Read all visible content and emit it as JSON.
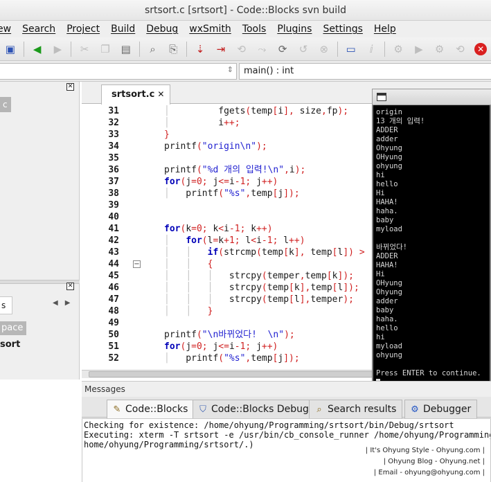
{
  "window": {
    "title": "srtsort.c [srtsort] - Code::Blocks svn build"
  },
  "menu": [
    "ew",
    "Search",
    "Project",
    "Build",
    "Debug",
    "wxSmith",
    "Tools",
    "Plugins",
    "Settings",
    "Help"
  ],
  "context": {
    "scope": "",
    "function": "main() : int"
  },
  "left_panel": {
    "button_fragment": "c",
    "tab_fragment": "s",
    "highlight_fragment": "pace",
    "bold_fragment": "sort"
  },
  "editor": {
    "tab_label": "srtsort.c",
    "tab_close": "✕",
    "lines": [
      {
        "n": "31",
        "html": "<span class=\"gl\">│</span>         fgets<span class=\"op\">(</span>temp<span class=\"op\">[</span>i<span class=\"op\">],</span> size<span class=\"op\">,</span>fp<span class=\"op\">);</span>"
      },
      {
        "n": "32",
        "html": "<span class=\"gl\">│</span>         i<span class=\"op\">++;</span>"
      },
      {
        "n": "33",
        "html": "<span class=\"op\">}</span>"
      },
      {
        "n": "34",
        "html": "printf<span class=\"op\">(</span><span class=\"str\">\"origin\\n\"</span><span class=\"op\">);</span>"
      },
      {
        "n": "35",
        "html": ""
      },
      {
        "n": "36",
        "html": "printf<span class=\"op\">(</span><span class=\"str\">\"%d 개의 입력!\\n\"</span><span class=\"op\">,</span>i<span class=\"op\">);</span>"
      },
      {
        "n": "37",
        "html": "<span class=\"kw\">for</span><span class=\"op\">(</span>j<span class=\"op\">=</span><span class=\"num\">0</span><span class=\"op\">;</span> j<span class=\"op\">&lt;=</span>i<span class=\"op\">-</span><span class=\"num\">1</span><span class=\"op\">;</span> j<span class=\"op\">++)</span>"
      },
      {
        "n": "38",
        "html": "<span class=\"gl\">│</span>   printf<span class=\"op\">(</span><span class=\"str\">\"%s\"</span><span class=\"op\">,</span>temp<span class=\"op\">[</span>j<span class=\"op\">]);</span>"
      },
      {
        "n": "39",
        "html": ""
      },
      {
        "n": "40",
        "html": ""
      },
      {
        "n": "41",
        "html": "<span class=\"kw\">for</span><span class=\"op\">(</span>k<span class=\"op\">=</span><span class=\"num\">0</span><span class=\"op\">;</span> k<span class=\"op\">&lt;</span>i<span class=\"op\">-</span><span class=\"num\">1</span><span class=\"op\">;</span> k<span class=\"op\">++)</span>"
      },
      {
        "n": "42",
        "html": "<span class=\"gl\">│</span>   <span class=\"kw\">for</span><span class=\"op\">(</span>l<span class=\"op\">=</span>k<span class=\"op\">+</span><span class=\"num\">1</span><span class=\"op\">;</span> l<span class=\"op\">&lt;</span>i<span class=\"op\">-</span><span class=\"num\">1</span><span class=\"op\">;</span> l<span class=\"op\">++)</span>"
      },
      {
        "n": "43",
        "html": "<span class=\"gl\">│</span>   <span class=\"gl\">│</span>   <span class=\"kw\">if</span><span class=\"op\">(</span>strcmp<span class=\"op\">(</span>temp<span class=\"op\">[</span>k<span class=\"op\">],</span> temp<span class=\"op\">[</span>l<span class=\"op\">])</span> <span class=\"op\">&gt;</span>"
      },
      {
        "n": "44",
        "html": "<span class=\"gl\">│</span>   <span class=\"gl\">│</span>   <span class=\"op\">{</span>",
        "fold": true
      },
      {
        "n": "45",
        "html": "<span class=\"gl\">│</span>   <span class=\"gl\">│</span>   <span class=\"gl\">│</span>   strcpy<span class=\"op\">(</span>temper<span class=\"op\">,</span>temp<span class=\"op\">[</span>k<span class=\"op\">]);</span>"
      },
      {
        "n": "46",
        "html": "<span class=\"gl\">│</span>   <span class=\"gl\">│</span>   <span class=\"gl\">│</span>   strcpy<span class=\"op\">(</span>temp<span class=\"op\">[</span>k<span class=\"op\">],</span>temp<span class=\"op\">[</span>l<span class=\"op\">]);</span>"
      },
      {
        "n": "47",
        "html": "<span class=\"gl\">│</span>   <span class=\"gl\">│</span>   <span class=\"gl\">│</span>   strcpy<span class=\"op\">(</span>temp<span class=\"op\">[</span>l<span class=\"op\">],</span>temper<span class=\"op\">);</span>"
      },
      {
        "n": "48",
        "html": "<span class=\"gl\">│</span>   <span class=\"gl\">│</span>   <span class=\"op\">}</span>"
      },
      {
        "n": "49",
        "html": ""
      },
      {
        "n": "50",
        "html": "printf<span class=\"op\">(</span><span class=\"str\">\"\\n바뀌었다!  \\n\"</span><span class=\"op\">);</span>"
      },
      {
        "n": "51",
        "html": "<span class=\"kw\">for</span><span class=\"op\">(</span>j<span class=\"op\">=</span><span class=\"num\">0</span><span class=\"op\">;</span> j<span class=\"op\">&lt;=</span>i<span class=\"op\">-</span><span class=\"num\">1</span><span class=\"op\">;</span> j<span class=\"op\">++)</span>"
      },
      {
        "n": "52",
        "html": "<span class=\"gl\">│</span>   printf<span class=\"op\">(</span><span class=\"str\">\"%s\"</span><span class=\"op\">,</span>temp<span class=\"op\">[</span>j<span class=\"op\">]);</span>"
      }
    ]
  },
  "console": {
    "text": "origin\n13 개의 입력!\nADDER\nadder\nOhyung\nOHyung\nohyung\nhi\nhello\nHi\nHAHA!\nhaha.\nbaby\nmyload\n\n바뀌었다!\nADDER\nHAHA!\nHi\nOHyung\nOhyung\nadder\nbaby\nhaha.\nhello\nhi\nmyload\nohyung\n\nPress ENTER to continue."
  },
  "messages": {
    "title": "Messages",
    "tabs": [
      {
        "label": "Code::Blocks",
        "icon": "pencil-icon"
      },
      {
        "label": "Code::Blocks Debug",
        "icon": "shield-icon"
      },
      {
        "label": "Search results",
        "icon": "magnifier-icon"
      },
      {
        "label": "Debugger",
        "icon": "gear-icon"
      }
    ],
    "lines": [
      "Checking for existence: /home/ohyung/Programming/srtsort/bin/Debug/srtsort",
      "Executing: xterm -T srtsort -e /usr/bin/cb_console_runner /home/ohyung/Programming/s",
      "home/ohyung/Programming/srtsort/.)"
    ],
    "watermark": [
      "| It's Ohyung Style - Ohyung.com |",
      "| Ohyung Blog - Ohyung.net |",
      "| Email - ohyung@ohyung.com |"
    ]
  }
}
